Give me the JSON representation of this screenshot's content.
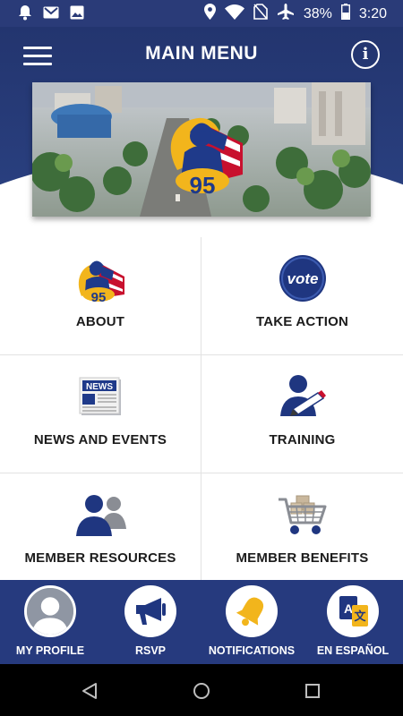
{
  "status_bar": {
    "battery": "38%",
    "time": "3:20",
    "icons": [
      "notification-bell-icon",
      "gmail-icon",
      "photos-icon",
      "location-icon",
      "wifi-icon",
      "no-sim-icon",
      "airplane-icon",
      "battery-icon"
    ]
  },
  "header": {
    "title": "MAIN MENU",
    "menu_icon": "hamburger-icon",
    "info_icon": "info-icon",
    "banner_badge_text": "95"
  },
  "menu": [
    {
      "label": "ABOUT",
      "icon": "local-95-logo-icon",
      "badge": "95"
    },
    {
      "label": "TAKE ACTION",
      "icon": "vote-icon",
      "badge": "vote"
    },
    {
      "label": "NEWS AND EVENTS",
      "icon": "newspaper-icon",
      "badge": "NEWS"
    },
    {
      "label": "TRAINING",
      "icon": "training-icon"
    },
    {
      "label": "MEMBER RESOURCES",
      "icon": "members-icon"
    },
    {
      "label": "MEMBER BENEFITS",
      "icon": "shopping-cart-icon"
    }
  ],
  "bottom_nav": [
    {
      "label": "MY PROFILE",
      "icon": "profile-avatar-icon"
    },
    {
      "label": "RSVP",
      "icon": "megaphone-icon"
    },
    {
      "label": "NOTIFICATIONS",
      "icon": "bell-icon"
    },
    {
      "label": "EN ESPAÑOL",
      "icon": "translate-icon"
    }
  ],
  "colors": {
    "primary": "#263a7e",
    "gold": "#f2b51c",
    "white": "#ffffff"
  }
}
